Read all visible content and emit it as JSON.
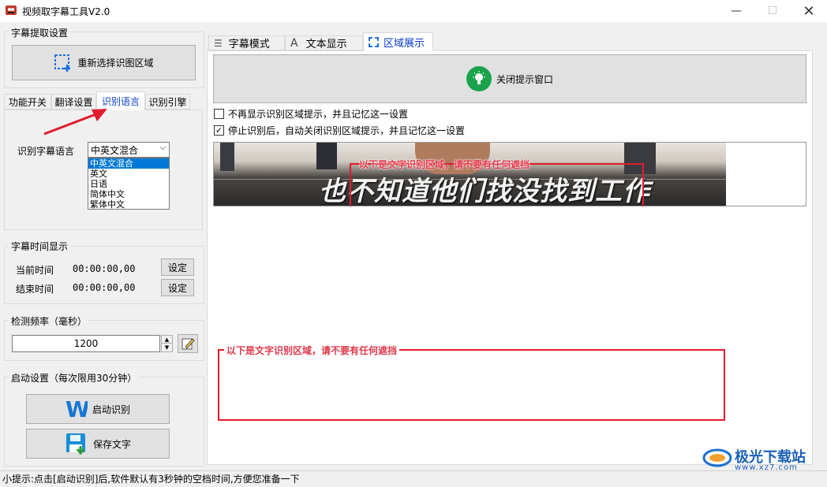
{
  "window": {
    "title": "视频取字幕工具V2.0",
    "min": "—",
    "max": "☐",
    "close": "✕"
  },
  "extract_settings": {
    "title": "字幕提取设置",
    "reselect_button": "重新选择识图区域"
  },
  "left_tabs": [
    "功能开关",
    "翻译设置",
    "识别语言",
    "识别引擎"
  ],
  "recognition_language": {
    "label": "识别字幕语言",
    "selected": "中英文混合",
    "options": [
      "中英文混合",
      "英文",
      "日语",
      "简体中文",
      "繁体中文"
    ]
  },
  "subtitle_time": {
    "title": "字幕时间显示",
    "current_label": "当前时间",
    "current_value": "00:00:00,00",
    "end_label": "结束时间",
    "end_value": "00:00:00,00",
    "set_button": "设定"
  },
  "detect_frequency": {
    "title": "检测频率（毫秒）",
    "value": "1200"
  },
  "start_settings": {
    "title": "启动设置（每次限用30分钟）",
    "start_button": "启动识别",
    "save_button": "保存文字"
  },
  "right_tabs": [
    "字幕模式",
    "文本显示",
    "区域展示"
  ],
  "region_display": {
    "close_hint_button": "关闭提示窗口",
    "checkbox1": "不再显示识别区域提示，并且记忆这一设置",
    "checkbox1_checked": false,
    "checkbox2": "停止识别后，自动关闭识别区域提示，并且记忆这一设置",
    "checkbox2_checked": true,
    "preview_hint": "以下是文字识别区域，请不要有任何遮挡",
    "preview_subtitle": "也不知道他们找没找到工作",
    "region_hint": "以下是文字识别区域，请不要有任何遮挡"
  },
  "watermark": {
    "name": "极光下载站",
    "url": "www.xz7.com"
  },
  "status_bar": "小提示:点击[启动识别]后,软件默认有3秒钟的空档时间,方便您准备一下",
  "colors": {
    "accent_blue": "#0a3cd1",
    "highlight_red": "#e01b2b",
    "bulb_green": "#1aa34a"
  }
}
